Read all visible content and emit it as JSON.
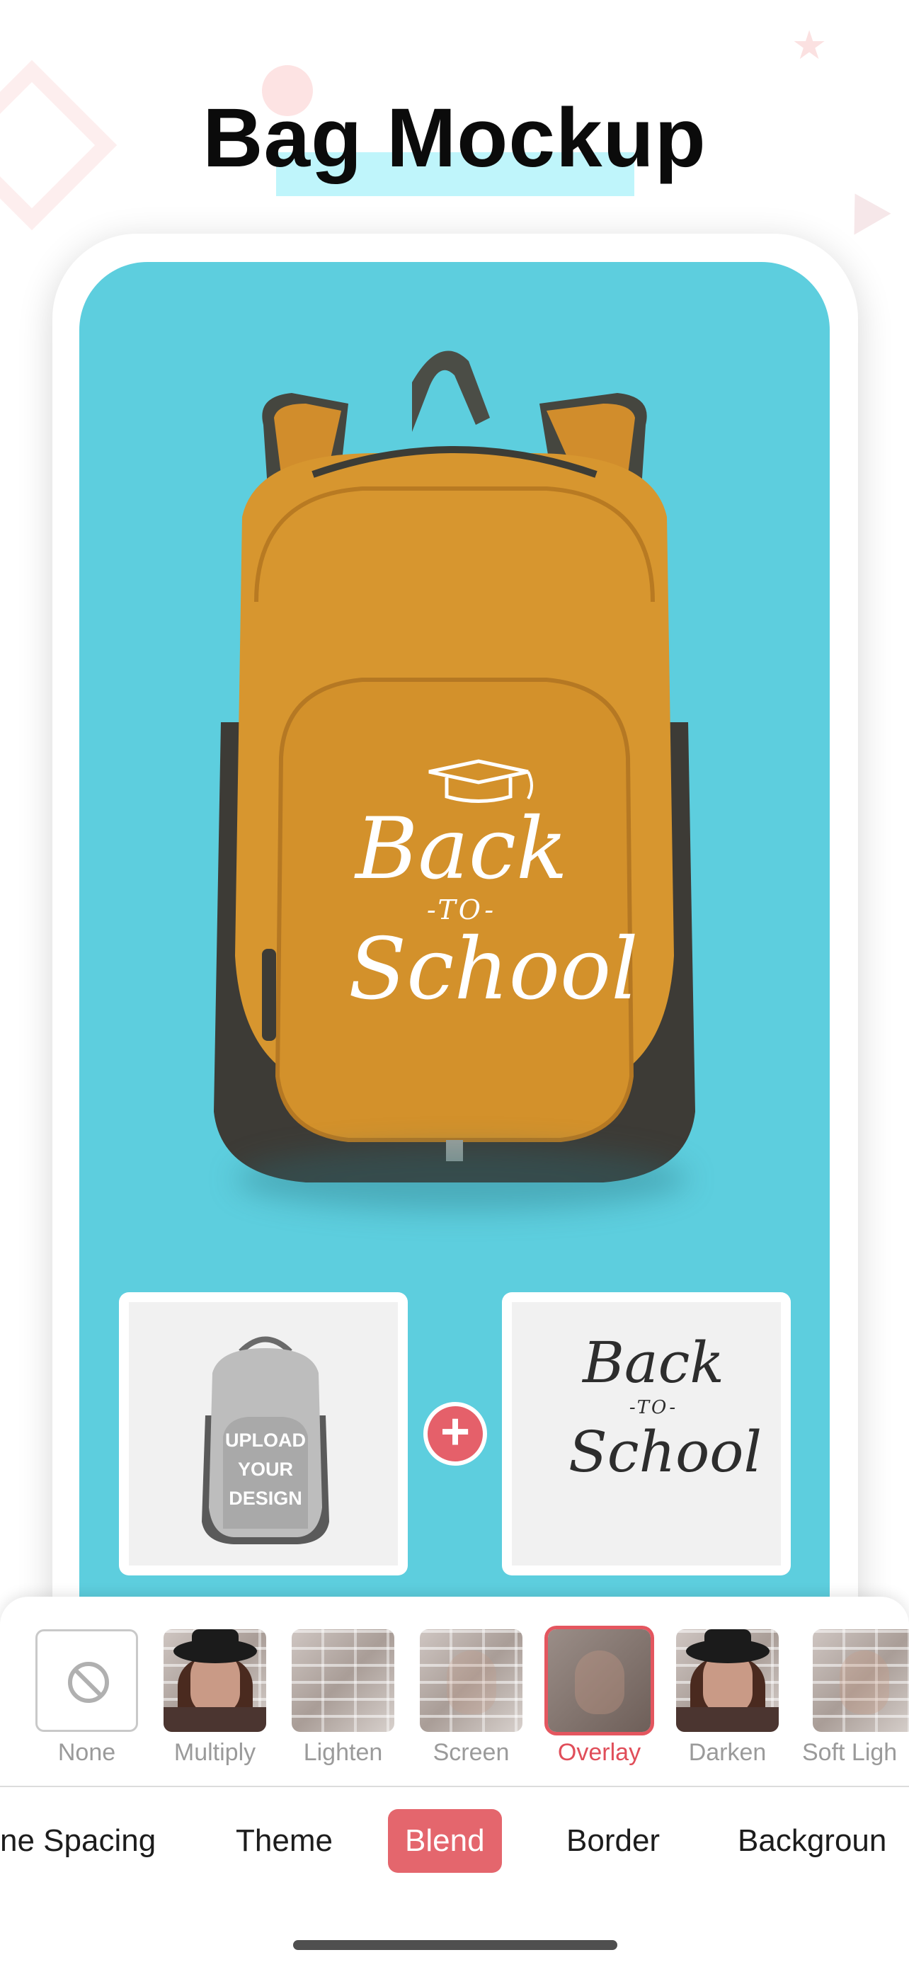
{
  "header": {
    "title": "Bag Mockup"
  },
  "mockup": {
    "design_text": {
      "line1": "Back",
      "line2": "-TO-",
      "line3": "School"
    }
  },
  "inputs": {
    "template_text": [
      "UPLOAD",
      "YOUR",
      "DESIGN"
    ],
    "design_text": {
      "line1": "Back",
      "line2": "-TO-",
      "line3": "School"
    },
    "plus_symbol": "+"
  },
  "blend_modes": [
    {
      "label": "None",
      "icon": "none-icon"
    },
    {
      "label": "Multiply",
      "icon": "portrait-thumb"
    },
    {
      "label": "Lighten",
      "icon": "brick-thumb"
    },
    {
      "label": "Screen",
      "icon": "brick-thumb"
    },
    {
      "label": "Overlay",
      "icon": "brick-thumb",
      "selected": true
    },
    {
      "label": "Darken",
      "icon": "portrait-thumb"
    },
    {
      "label": "Soft Ligh",
      "icon": "brick-thumb"
    }
  ],
  "tabs": [
    {
      "label": "ne Spacing"
    },
    {
      "label": "Theme"
    },
    {
      "label": "Blend",
      "selected": true
    },
    {
      "label": "Border"
    },
    {
      "label": "Backgroun"
    }
  ],
  "colors": {
    "screen_bg": "#5dcede",
    "accent": "#e4666d",
    "bag_orange": "#d7962f",
    "bag_dark": "#3d3b36"
  }
}
